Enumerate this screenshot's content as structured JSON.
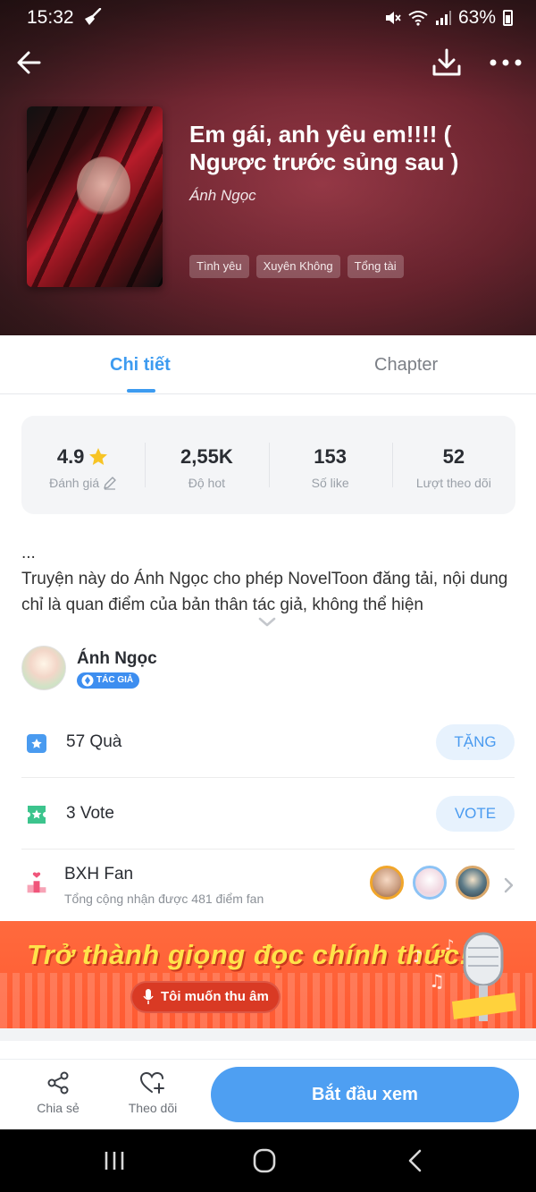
{
  "status_bar": {
    "time": "15:32",
    "battery": "63%"
  },
  "book": {
    "title": "Em gái, anh yêu em!!!! ( Ngược trước sủng sau )",
    "author": "Ánh Ngọc",
    "tags": [
      "Tình yêu",
      "Xuyên Không",
      "Tổng tài"
    ]
  },
  "tabs": {
    "detail": "Chi tiết",
    "chapter": "Chapter"
  },
  "stats": [
    {
      "value": "4.9",
      "label": "Đánh giá"
    },
    {
      "value": "2,55K",
      "label": "Độ hot"
    },
    {
      "value": "153",
      "label": "Số like"
    },
    {
      "value": "52",
      "label": "Lượt theo dõi"
    }
  ],
  "description": "...\nTruyện này do Ánh Ngọc cho phép NovelToon đăng tải, nội dung chỉ là quan điểm của bản thân tác giả, không thể hiện",
  "author_section": {
    "name": "Ánh Ngọc",
    "badge": "TÁC GIẢ"
  },
  "gifts": {
    "count": "57",
    "label": "Quà",
    "button": "TẶNG"
  },
  "votes": {
    "count": "3",
    "label": "Vote",
    "button": "VOTE"
  },
  "fan_ranking": {
    "title": "BXH Fan",
    "subtitle": "Tổng cộng nhận được 481 điểm fan"
  },
  "banner": {
    "title": "Trở thành giọng đọc chính thức!",
    "button": "Tôi muốn thu âm"
  },
  "actions": {
    "share": "Chia sẻ",
    "follow": "Theo dõi",
    "start": "Bắt đầu xem"
  },
  "colors": {
    "accent": "#3d9bf0",
    "start_button": "#4e9ff2",
    "banner_bg": "#ff5a32",
    "banner_title": "#ffe24a"
  }
}
